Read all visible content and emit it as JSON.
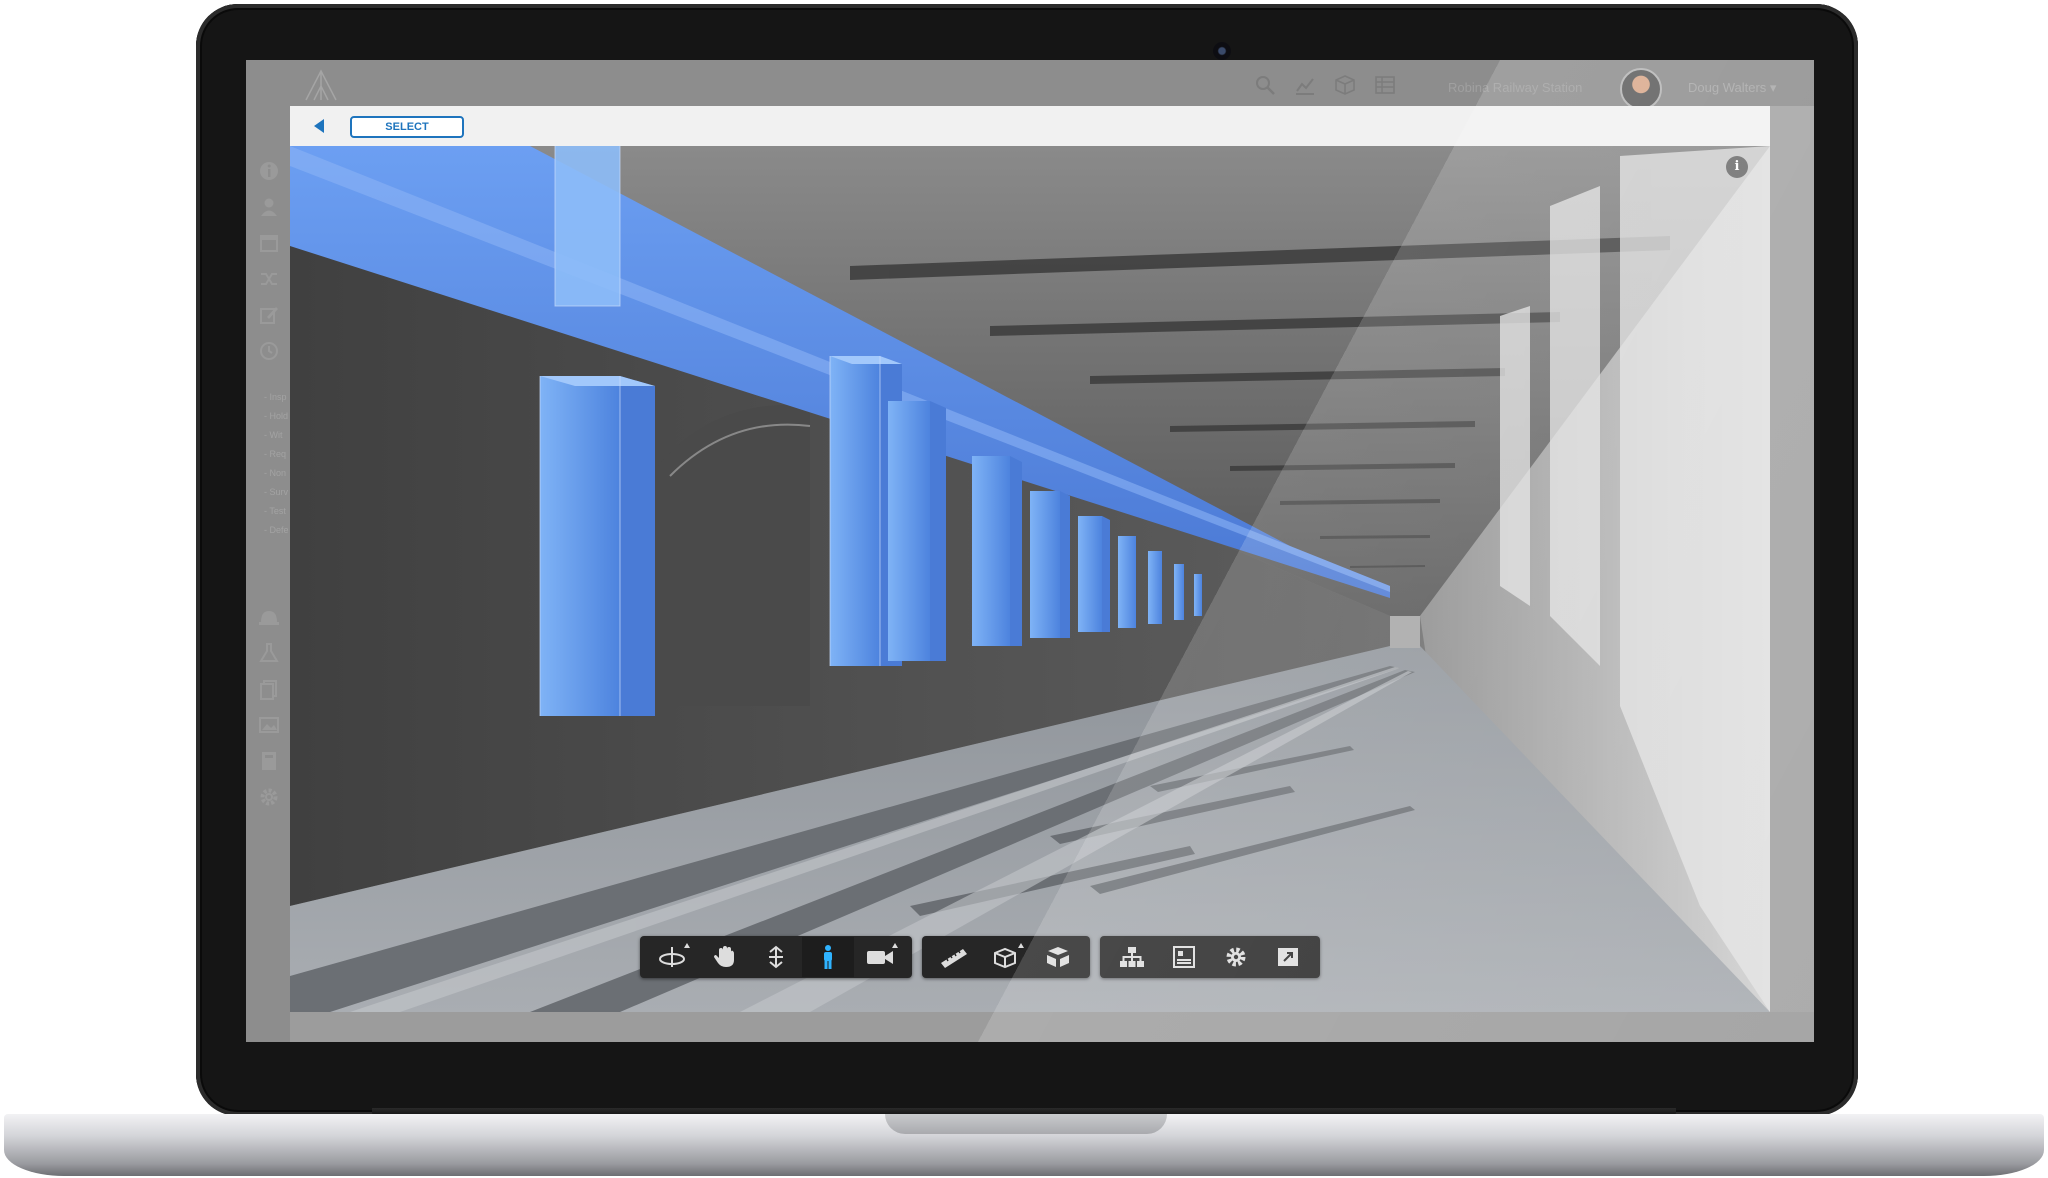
{
  "header": {
    "project_name": "Robina Railway Station",
    "user_name": "Doug Walters ▾"
  },
  "sidebar": {
    "icons": [
      "info-icon",
      "person-icon",
      "calendar-icon",
      "shuffle-icon",
      "edit-icon",
      "clock-icon"
    ],
    "sub_items": [
      "- Insp",
      "- Hold",
      "- Wit",
      "- Req",
      "- Non",
      "- Surv",
      "- Test",
      "- Defe"
    ],
    "bottom_icons": [
      "hardhat-icon",
      "flask-icon",
      "documents-icon",
      "image-icon",
      "book-icon",
      "settings-icon"
    ]
  },
  "viewer": {
    "select_label": "SELECT",
    "info_label": "i"
  },
  "toolbar": {
    "groups": [
      [
        "orbit-icon",
        "pan-icon",
        "zoom-icon",
        "first-person-icon",
        "camera-icon"
      ],
      [
        "measure-icon",
        "section-icon",
        "explode-icon"
      ],
      [
        "model-browser-icon",
        "properties-icon",
        "settings-icon",
        "fullscreen-icon"
      ]
    ],
    "active": "first-person-icon"
  },
  "colors": {
    "accent": "#1e74bd",
    "duct": "#5b8de6",
    "toolbar_bg": "#262626",
    "active_tool": "#2fb3ff"
  }
}
